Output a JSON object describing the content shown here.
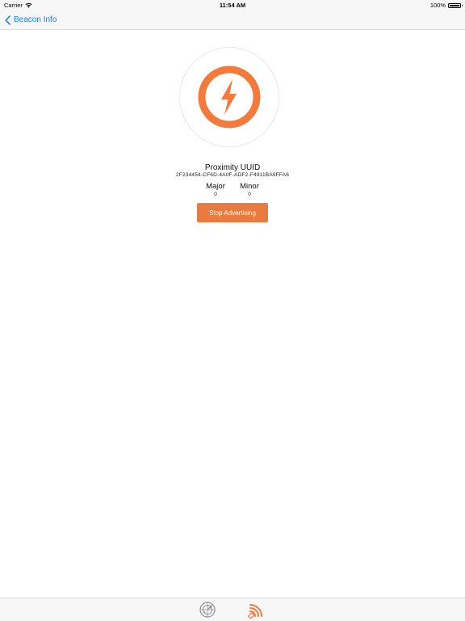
{
  "status_bar": {
    "carrier": "Carrier",
    "time": "11:54 AM",
    "battery": "100%",
    "battery_level": 1.0
  },
  "nav": {
    "back_label": "Beacon Info"
  },
  "beacon": {
    "icon": "lightning-bolt-icon",
    "accent_color": "#f47a3c",
    "uuid_title": "Proximity UUID",
    "uuid_value": "2F234454-CF6D-4A0F-ADF2-F4911BA9FFA6",
    "major_label": "Major",
    "major_value": "0",
    "minor_label": "Minor",
    "minor_value": "0"
  },
  "actions": {
    "stop_label": "Stop Advertising",
    "stop_color": "#ea7b40"
  },
  "tab_bar": {
    "tabs": [
      {
        "icon": "radar-icon",
        "active": false
      },
      {
        "icon": "broadcast-icon",
        "active": true
      }
    ],
    "active_color": "#f47a3c",
    "inactive_color": "#8e8e93"
  }
}
